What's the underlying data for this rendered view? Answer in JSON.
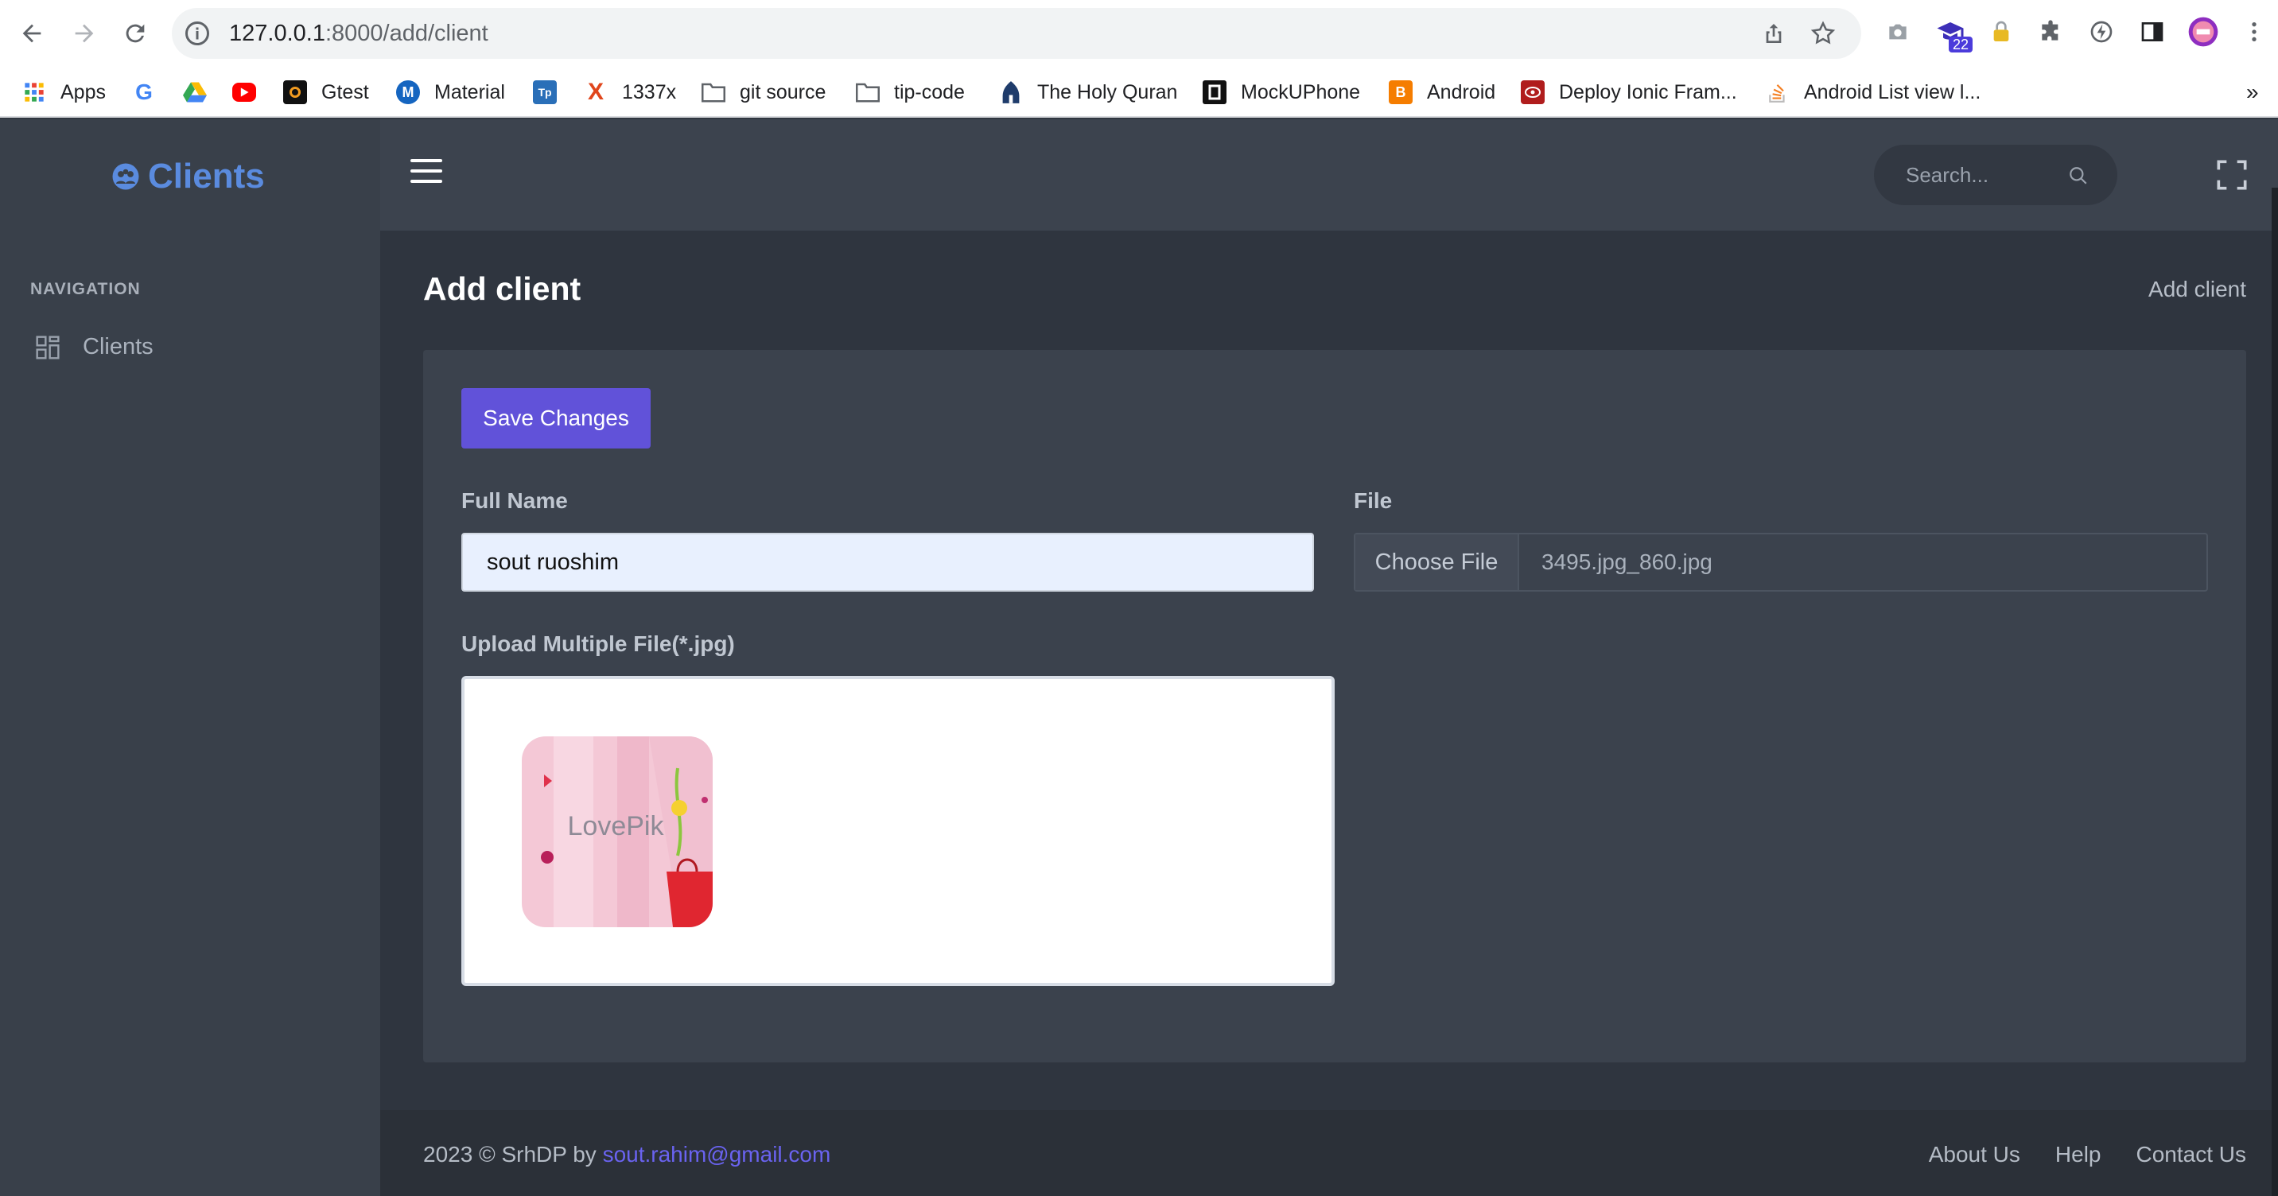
{
  "browser": {
    "url_host": "127.0.0.1",
    "url_path": ":8000/add/client",
    "profile_badge": "22",
    "bookmarks": [
      {
        "label": "Apps",
        "icon": "apps-grid-icon"
      },
      {
        "label": "",
        "icon": "google-icon"
      },
      {
        "label": "",
        "icon": "google-drive-icon"
      },
      {
        "label": "",
        "icon": "youtube-icon"
      },
      {
        "label": "Gtest",
        "icon": "gtest-icon"
      },
      {
        "label": "Material",
        "icon": "material-icon"
      },
      {
        "label": "",
        "icon": "tp-icon"
      },
      {
        "label": "1337x",
        "icon": "x-icon"
      },
      {
        "label": "git source",
        "icon": "folder-icon"
      },
      {
        "label": "tip-code",
        "icon": "folder-icon"
      },
      {
        "label": "The Holy Quran",
        "icon": "quran-icon"
      },
      {
        "label": "MockUPhone",
        "icon": "mockuphone-icon"
      },
      {
        "label": "Android",
        "icon": "blogger-icon"
      },
      {
        "label": "Deploy Ionic Fram...",
        "icon": "ionic-icon"
      },
      {
        "label": "Android List view l...",
        "icon": "stackoverflow-icon"
      }
    ],
    "more_bookmarks": "»"
  },
  "sidebar": {
    "brand": "Clients",
    "nav_heading": "NAVIGATION",
    "items": [
      {
        "label": "Clients",
        "icon": "grid-icon"
      }
    ]
  },
  "topbar": {
    "search_placeholder": "Search..."
  },
  "page": {
    "title": "Add client",
    "breadcrumb": "Add client"
  },
  "form": {
    "save_label": "Save Changes",
    "full_name_label": "Full Name",
    "full_name_value": "sout ruoshim",
    "file_label": "File",
    "choose_file_label": "Choose File",
    "file_name": "3495.jpg_860.jpg",
    "upload_label": "Upload Multiple File(*.jpg)",
    "thumbnail_text": "LovePik"
  },
  "footer": {
    "copyright": "2023 © SrhDP by ",
    "email": "sout.rahim@gmail.com",
    "links": [
      "About Us",
      "Help",
      "Contact Us"
    ]
  },
  "colors": {
    "accent": "#6152d9",
    "brand": "#5a8bdf",
    "sidebar_bg": "#39404a",
    "content_bg": "#2f353f",
    "card_bg": "#3b424d"
  }
}
